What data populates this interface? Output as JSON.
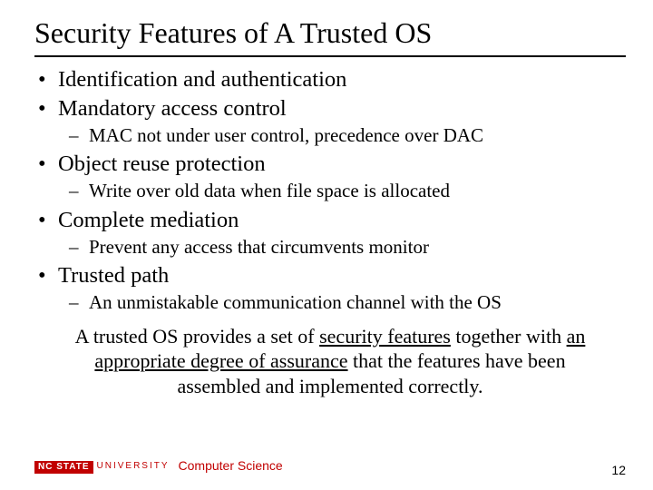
{
  "title": "Security Features of A Trusted OS",
  "bullets": {
    "b1": "Identification and authentication",
    "b2": "Mandatory access control",
    "b2_1": "MAC not under user control, precedence over DAC",
    "b3": "Object reuse protection",
    "b3_1": "Write over old data when file space is allocated",
    "b4": "Complete mediation",
    "b4_1": "Prevent any access that circumvents monitor",
    "b5": "Trusted path",
    "b5_1": "An unmistakable communication channel with the OS"
  },
  "summary": {
    "s1": "A trusted OS provides a set of ",
    "u1": "security features",
    "s2": " together with ",
    "u2": "an appropriate degree of assurance",
    "s3": " that the features have been assembled and implemented correctly."
  },
  "footer": {
    "logo_brand": "NC STATE",
    "logo_uni": "UNIVERSITY",
    "dept": "Computer Science",
    "page": "12"
  }
}
